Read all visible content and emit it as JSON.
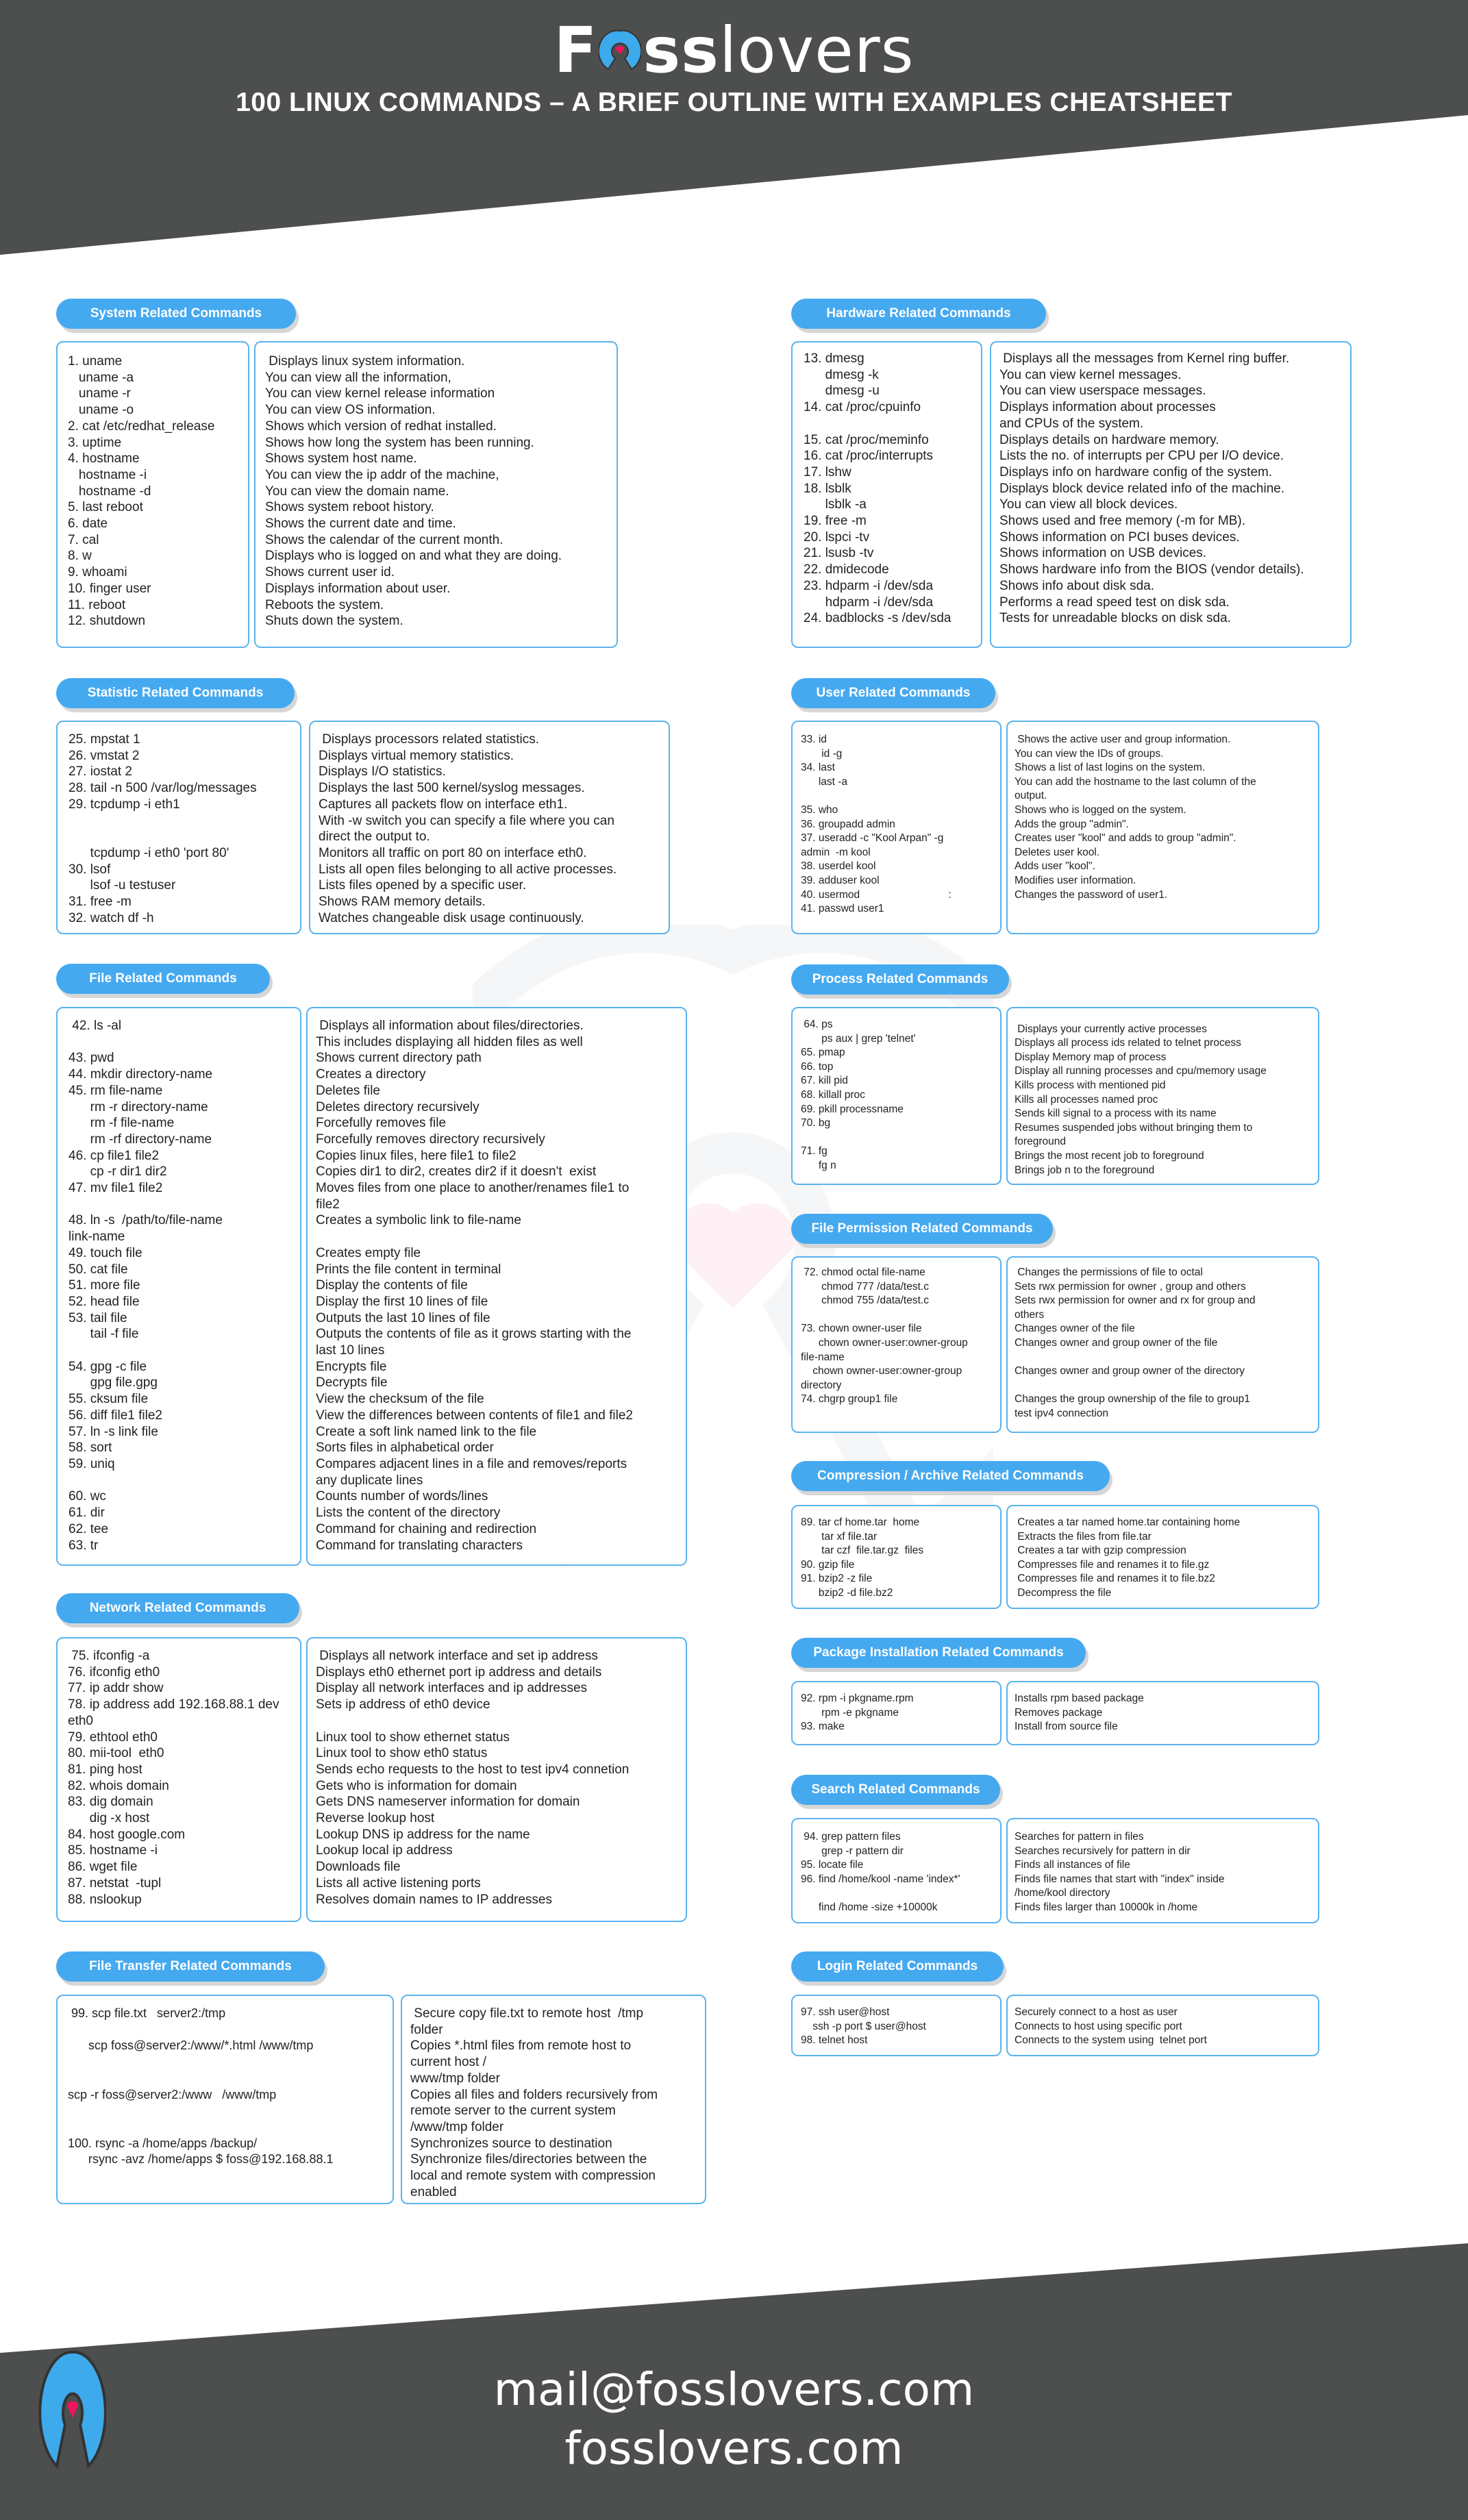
{
  "header": {
    "brand_bold_prefix": "F",
    "brand_bold_suffix": "ss",
    "brand_light": "lovers",
    "subtitle": "100 LINUX COMMANDS – A BRIEF OUTLINE WITH EXAMPLES CHEATSHEET"
  },
  "colors": {
    "dark_band": "#4d4f4f",
    "accent_blue": "#45a9f0",
    "border_blue": "#5ab3ee",
    "heart_pink": "#f0155a"
  },
  "sections": {
    "system": {
      "title": "System Related Commands",
      "commands": [
        "1. uname",
        "   uname -a",
        "   uname -r",
        "   uname -o",
        "2. cat /etc/redhat_release",
        "3. uptime",
        "4. hostname",
        "   hostname -i",
        "   hostname -d",
        "5. last reboot",
        "6. date",
        "7. cal",
        "8. w",
        "9. whoami",
        "10. finger user",
        "11. reboot",
        "12. shutdown"
      ],
      "descriptions": [
        " Displays linux system information.",
        "You can view all the information,",
        "You can view kernel release information",
        "You can view OS information.",
        "Shows which version of redhat installed.",
        "Shows how long the system has been running.",
        "Shows system host name.",
        "You can view the ip addr of the machine,",
        "You can view the domain name.",
        "Shows system reboot history.",
        "Shows the current date and time.",
        "Shows the calendar of the current month.",
        "Displays who is logged on and what they are doing.",
        "Shows current user id.",
        "Displays information about user.",
        "Reboots the system.",
        "Shuts down the system."
      ]
    },
    "hardware": {
      "title": "Hardware Related Commands",
      "commands": [
        "13. dmesg",
        "      dmesg -k",
        "      dmesg -u",
        "14. cat /proc/cpuinfo",
        "",
        "15. cat /proc/meminfo",
        "16. cat /proc/interrupts",
        "17. lshw",
        "18. lsblk",
        "      lsblk -a",
        "19. free -m",
        "20. lspci -tv",
        "21. lsusb -tv",
        "22. dmidecode",
        "23. hdparm -i /dev/sda",
        "      hdparm -i /dev/sda",
        "24. badblocks -s /dev/sda"
      ],
      "descriptions": [
        " Displays all the messages from Kernel ring buffer.",
        "You can view kernel messages.",
        "You can view userspace messages.",
        "Displays information about processes",
        "and CPUs of the system.",
        "Displays details on hardware memory.",
        "Lists the no. of interrupts per CPU per I/O device.",
        "Displays info on hardware config of the system.",
        "Displays block device related info of the machine.",
        "You can view all block devices.",
        "Shows used and free memory (-m for MB).",
        "Shows information on PCI buses devices.",
        "Shows information on USB devices.",
        "Shows hardware info from the BIOS (vendor details).",
        "Shows info about disk sda.",
        "Performs a read speed test on disk sda.",
        "Tests for unreadable blocks on disk sda."
      ]
    },
    "statistic": {
      "title": "Statistic Related Commands",
      "commands": [
        "25. mpstat 1",
        "26. vmstat 2",
        "27. iostat 2",
        "28. tail -n 500 /var/log/messages",
        "29. tcpdump -i eth1",
        "",
        "",
        "      tcpdump -i eth0 'port 80'",
        "30. lsof",
        "      lsof -u testuser",
        "31. free -m",
        "32. watch df -h"
      ],
      "descriptions": [
        " Displays processors related statistics.",
        "Displays virtual memory statistics.",
        "Displays I/O statistics.",
        "Displays the last 500 kernel/syslog messages.",
        "Captures all packets flow on interface eth1.",
        "With -w switch you can specify a file where you can",
        "direct the output to.",
        "Monitors all traffic on port 80 on interface eth0.",
        "Lists all open files belonging to all active processes.",
        "Lists files opened by a specific user.",
        "Shows RAM memory details.",
        "Watches changeable disk usage continuously."
      ]
    },
    "user": {
      "title": "User Related Commands",
      "commands": [
        "33. id",
        "       id -g",
        "34. last",
        "      last -a",
        "",
        "35. who",
        "36. groupadd admin",
        "37. useradd -c \"Kool Arpan\" -g",
        "admin  -m kool",
        "38. userdel kool",
        "39. adduser kool",
        "40. usermod                              :",
        "41. passwd user1"
      ],
      "descriptions": [
        " Shows the active user and group information.",
        "You can view the IDs of groups.",
        "Shows a list of last logins on the system.",
        "You can add the hostname to the last column of the",
        "output.",
        "Shows who is logged on the system.",
        "Adds the group \"admin\".",
        "Creates user \"kool\" and adds to group \"admin\".",
        "Deletes user kool.",
        "Adds user \"kool\".",
        "Modifies user information.",
        "Changes the password of user1."
      ]
    },
    "file": {
      "title": "File Related Commands",
      "commands": [
        " 42. ls -al",
        "",
        "43. pwd",
        "44. mkdir directory-name",
        "45. rm file-name",
        "      rm -r directory-name",
        "      rm -f file-name",
        "      rm -rf directory-name",
        "46. cp file1 file2",
        "      cp -r dir1 dir2",
        "47. mv file1 file2",
        "",
        "48. ln -s  /path/to/file-name",
        "link-name",
        "49. touch file",
        "50. cat file",
        "51. more file",
        "52. head file",
        "53. tail file",
        "      tail -f file",
        "",
        "54. gpg -c file",
        "      gpg file.gpg",
        "55. cksum file",
        "56. diff file1 file2",
        "57. ln -s link file",
        "58. sort",
        "59. uniq",
        "",
        "60. wc",
        "61. dir",
        "62. tee",
        "63. tr"
      ],
      "descriptions": [
        " Displays all information about files/directories.",
        "This includes displaying all hidden files as well",
        "Shows current directory path",
        "Creates a directory",
        "Deletes file",
        "Deletes directory recursively",
        "Forcefully removes file",
        "Forcefully removes directory recursively",
        "Copies linux files, here file1 to file2",
        "Copies dir1 to dir2, creates dir2 if it doesn't  exist",
        "Moves files from one place to another/renames file1 to",
        "file2",
        "Creates a symbolic link to file-name",
        "",
        "Creates empty file",
        "Prints the file content in terminal",
        "Display the contents of file",
        "Display the first 10 lines of file",
        "Outputs the last 10 lines of file",
        "Outputs the contents of file as it grows starting with the",
        "last 10 lines",
        "Encrypts file",
        "Decrypts file",
        "View the checksum of the file",
        "View the differences between contents of file1 and file2",
        "Create a soft link named link to the file",
        "Sorts files in alphabetical order",
        "Compares adjacent lines in a file and removes/reports",
        "any duplicate lines",
        "Counts number of words/lines",
        "Lists the content of the directory",
        "Command for chaining and redirection",
        "Command for translating characters"
      ]
    },
    "process": {
      "title": "Process Related Commands",
      "commands": [
        " 64. ps",
        "       ps aux | grep 'telnet'",
        "65. pmap",
        "66. top",
        "67. kill pid",
        "68. killall proc",
        "69. pkill processname",
        "70. bg",
        "",
        "71. fg",
        "      fg n"
      ],
      "descriptions": [
        "",
        " Displays your currently active processes",
        "Displays all process ids related to telnet process",
        "Display Memory map of process",
        "Display all running processes and cpu/memory usage",
        "Kills process with mentioned pid",
        "Kills all processes named proc",
        "Sends kill signal to a process with its name",
        "Resumes suspended jobs without bringing them to",
        "foreground",
        "Brings the most recent job to foreground",
        "Brings job n to the foreground"
      ]
    },
    "permission": {
      "title": "File Permission Related Commands",
      "commands": [
        " 72. chmod octal file-name",
        "       chmod 777 /data/test.c",
        "       chmod 755 /data/test.c",
        "",
        "73. chown owner-user file",
        "      chown owner-user:owner-group",
        "file-name",
        "    chown owner-user:owner-group",
        "directory",
        "74. chgrp group1 file"
      ],
      "descriptions": [
        " Changes the permissions of file to octal",
        "Sets rwx permission for owner , group and others",
        "Sets rwx permission for owner and rx for group and",
        "others",
        "Changes owner of the file",
        "Changes owner and group owner of the file",
        "",
        "Changes owner and group owner of the directory",
        "",
        "Changes the group ownership of the file to group1",
        "test ipv4 connection"
      ]
    },
    "network": {
      "title": "Network Related Commands",
      "commands": [
        " 75. ifconfig -a",
        "76. ifconfig eth0",
        "77. ip addr show",
        "78. ip address add 192.168.88.1 dev",
        "eth0",
        "79. ethtool eth0",
        "80. mii-tool  eth0",
        "81. ping host",
        "82. whois domain",
        "83. dig domain",
        "      dig -x host",
        "84. host google.com",
        "85. hostname -i",
        "86. wget file",
        "87. netstat  -tupl",
        "88. nslookup"
      ],
      "descriptions": [
        " Displays all network interface and set ip address",
        "Displays eth0 ethernet port ip address and details",
        "Display all network interfaces and ip addresses",
        "Sets ip address of eth0 device",
        "",
        "Linux tool to show ethernet status",
        "Linux tool to show eth0 status",
        "Sends echo requests to the host to test ipv4 connetion",
        "Gets who is information for domain",
        "Gets DNS nameserver information for domain",
        "Reverse lookup host",
        "Lookup DNS ip address for the name",
        "Lookup local ip address",
        "Downloads file",
        "Lists all active listening ports",
        "Resolves domain names to IP addresses"
      ]
    },
    "compression": {
      "title": "Compression / Archive Related Commands",
      "commands": [
        "89. tar cf home.tar  home",
        "       tar xf file.tar",
        "       tar czf  file.tar.gz  files",
        "90. gzip file",
        "91. bzip2 -z file",
        "      bzip2 -d file.bz2"
      ],
      "descriptions": [
        " Creates a tar named home.tar containing home",
        " Extracts the files from file.tar",
        " Creates a tar with gzip compression",
        " Compresses file and renames it to file.gz",
        " Compresses file and renames it to file.bz2",
        " Decompress the file"
      ]
    },
    "package": {
      "title": "Package Installation Related Commands",
      "commands": [
        "92. rpm -i pkgname.rpm",
        "       rpm -e pkgname",
        "93. make"
      ],
      "descriptions": [
        "Installs rpm based package",
        "Removes package",
        "Install from source file"
      ]
    },
    "search": {
      "title": "Search Related Commands",
      "commands": [
        " 94. grep pattern files",
        "       grep -r pattern dir",
        "95. locate file",
        "96. find /home/kool -name 'index*'",
        "",
        "      find /home -size +10000k"
      ],
      "descriptions": [
        "Searches for pattern in files",
        "Searches recursively for pattern in dir",
        "Finds all instances of file",
        "Finds file names that start with \"index\" inside",
        "/home/kool directory",
        "Finds files larger than 10000k in /home"
      ]
    },
    "login": {
      "title": "Login Related Commands",
      "commands": [
        "97. ssh user@host",
        "    ssh -p port $ user@host",
        "98. telnet host"
      ],
      "descriptions": [
        "Securely connect to a host as user",
        "Connects to host using specific port",
        "Connects to the system using  telnet port"
      ]
    },
    "transfer": {
      "title": "File Transfer Related Commands",
      "commands": [
        " 99. scp file.txt   server2:/tmp",
        "",
        "      scp foss@server2:/www/*.html /www/tmp",
        "",
        "",
        "scp -r foss@server2:/www   /www/tmp",
        "",
        "",
        "100. rsync -a /home/apps /backup/",
        "      rsync -avz /home/apps $ foss@192.168.88.1"
      ],
      "descriptions": [
        " Secure copy file.txt to remote host  /tmp",
        "folder",
        "Copies *.html files from remote host to",
        "current host /",
        "www/tmp folder",
        "Copies all files and folders recursively from",
        "remote server to the current system",
        "/www/tmp folder",
        "Synchronizes source to destination",
        "Synchronize files/directories between the",
        "local and remote system with compression",
        "enabled"
      ]
    }
  },
  "footer": {
    "email": "mail@fosslovers.com",
    "website": "fosslovers.com"
  }
}
